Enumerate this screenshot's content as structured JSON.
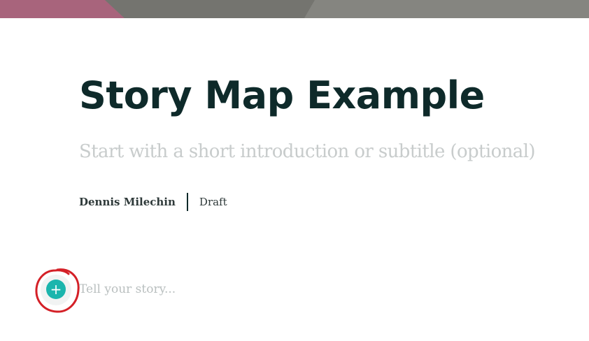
{
  "story": {
    "title": "Story Map Example",
    "subtitle_placeholder": "Start with a short introduction or subtitle (optional)",
    "author": "Dennis Milechin",
    "status": "Draft",
    "body_placeholder": "Tell your story...",
    "add_button_label": "+"
  },
  "colors": {
    "title": "#0e2a2a",
    "accent": "#1bb5ad",
    "placeholder": "#c8cccc",
    "annotation": "#d42027"
  },
  "icons": {
    "add": "plus-icon"
  }
}
